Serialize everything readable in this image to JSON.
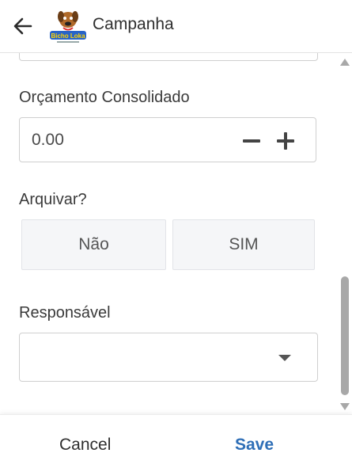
{
  "header": {
    "title": "Campanha",
    "back_icon": "arrow-left-icon",
    "logo_text": "Bicho Loka"
  },
  "form": {
    "budget": {
      "label": "Orçamento Consolidado",
      "value": "0.00"
    },
    "archive": {
      "label": "Arquivar?",
      "options": [
        "Não",
        "SIM"
      ]
    },
    "owner": {
      "label": "Responsável",
      "value": ""
    }
  },
  "footer": {
    "cancel_label": "Cancel",
    "save_label": "Save"
  },
  "colors": {
    "accent": "#2f6fb7",
    "border": "#cfcfcf",
    "segment_bg": "#f5f6f8"
  }
}
